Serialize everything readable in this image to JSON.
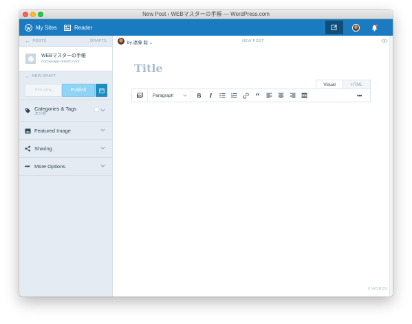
{
  "window": {
    "title": "New Post ‹ WEBマスターの手帳 — WordPress.com"
  },
  "topbar": {
    "my_sites_label": "My Sites",
    "reader_label": "Reader",
    "color": "#1a7bc1",
    "write_active_color": "#0f4d7a"
  },
  "sidebar": {
    "back_label": "POSTS",
    "drafts_label": "DRAFTS",
    "site_name": "WEBマスターの手帳",
    "site_url": "homepage-reborn.com",
    "new_draft_label": "NEW DRAFT",
    "preview_label": "Preview",
    "publish_label": "Publish",
    "sections": {
      "categories": {
        "label": "Categories & Tags",
        "sub": "未分類"
      },
      "featured": {
        "label": "Featured Image"
      },
      "sharing": {
        "label": "Sharing"
      },
      "more": {
        "label": "More Options"
      }
    }
  },
  "editor": {
    "author_label": "by 遠藤 聡",
    "status_label": "NEW POST",
    "title_placeholder": "Title",
    "tab_visual": "Visual",
    "tab_html": "HTML",
    "format_select": "Paragraph",
    "word_count": "0 WORDS"
  },
  "icons": {
    "wordpress": "wordpress-icon",
    "reader": "reader-icon",
    "write": "write-icon",
    "notifications": "bell-icon",
    "preview": "eye-icon"
  }
}
